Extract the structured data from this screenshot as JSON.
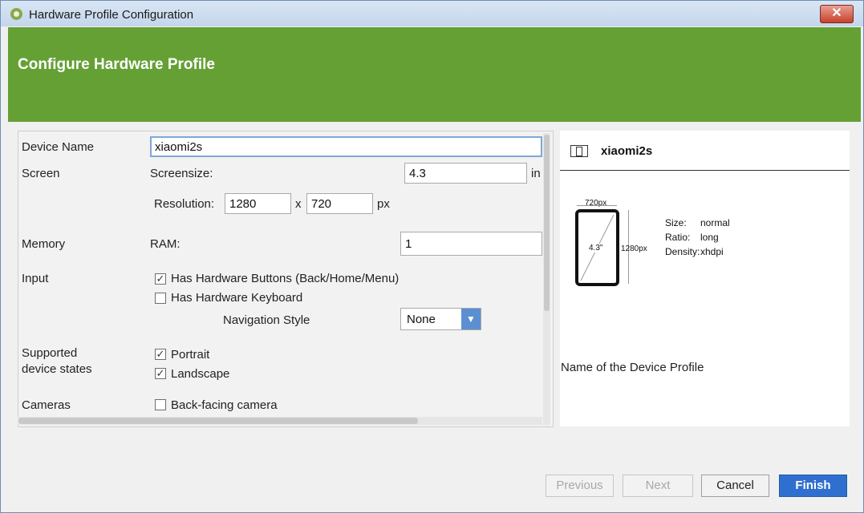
{
  "window": {
    "title": "Hardware Profile Configuration",
    "close_glyph": "✕"
  },
  "banner": {
    "title": "Configure Hardware Profile"
  },
  "form": {
    "device_name_label": "Device Name",
    "device_name_value": "xiaomi2s",
    "screen_label": "Screen",
    "screensize_label": "Screensize:",
    "screensize_value": "4.3",
    "screensize_unit": "in",
    "resolution_label": "Resolution:",
    "resolution_w": "1280",
    "resolution_x": "x",
    "resolution_h": "720",
    "resolution_unit": "px",
    "memory_label": "Memory",
    "ram_label": "RAM:",
    "ram_value": "1",
    "input_label": "Input",
    "hw_buttons_label": "Has Hardware Buttons (Back/Home/Menu)",
    "hw_buttons_checked": true,
    "hw_keyboard_label": "Has Hardware Keyboard",
    "hw_keyboard_checked": false,
    "nav_style_label": "Navigation Style",
    "nav_style_value": "None",
    "states_label_1": "Supported",
    "states_label_2": "device states",
    "portrait_label": "Portrait",
    "portrait_checked": true,
    "landscape_label": "Landscape",
    "landscape_checked": true,
    "cameras_label": "Cameras",
    "back_camera_label": "Back-facing camera",
    "back_camera_checked": false
  },
  "preview": {
    "name": "xiaomi2s",
    "width_px": "720px",
    "height_px": "1280px",
    "diagonal": "4.3\"",
    "size_key": "Size:",
    "size_val": "normal",
    "ratio_key": "Ratio:",
    "ratio_val": "long",
    "density_key": "Density:",
    "density_val": "xhdpi",
    "description": "Name of the Device Profile"
  },
  "buttons": {
    "previous": "Previous",
    "next": "Next",
    "cancel": "Cancel",
    "finish": "Finish"
  }
}
